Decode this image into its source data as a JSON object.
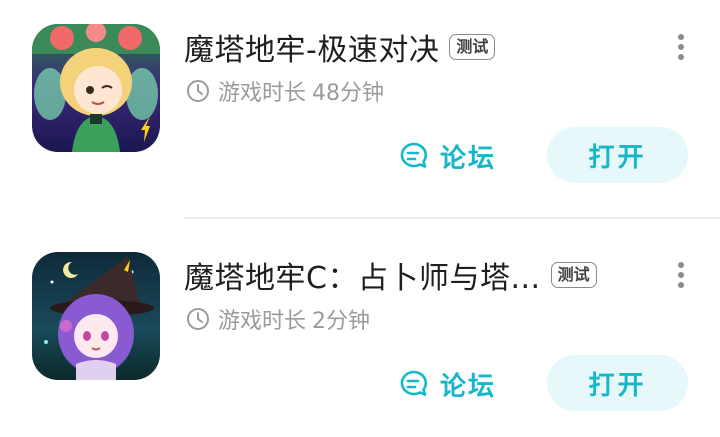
{
  "apps": [
    {
      "title": "魔塔地牢-极速对决",
      "badge": "测试",
      "playtime_label": "游戏时长",
      "playtime_value": "48分钟",
      "forum_label": "论坛",
      "open_label": "打开",
      "icon": "fairy-character-icon"
    },
    {
      "title": "魔塔地牢C：占卜师与塔...",
      "badge": "测试",
      "playtime_label": "游戏时长",
      "playtime_value": "2分钟",
      "forum_label": "论坛",
      "open_label": "打开",
      "icon": "witch-character-icon"
    }
  ],
  "colors": {
    "accent": "#16b7c8",
    "button_bg": "#e6f8f9",
    "secondary_text": "#9b9b9b",
    "title_text": "#1f1f1f"
  }
}
